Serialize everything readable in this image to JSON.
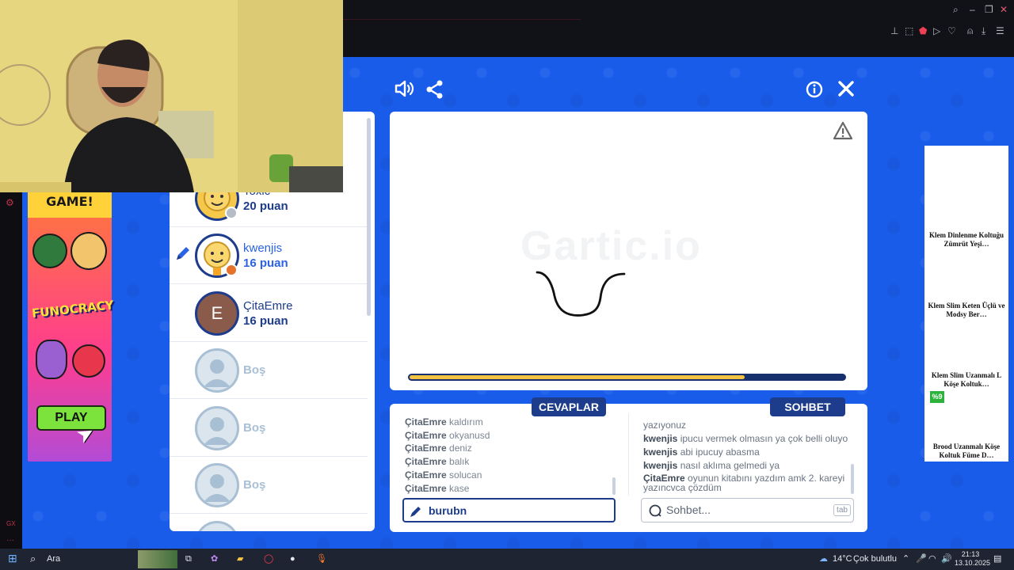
{
  "browser": {
    "icons": [
      "search-icon",
      "minimize-icon",
      "restore-icon",
      "close-icon",
      "pin-icon",
      "snapshot-icon",
      "pocket-icon",
      "play-icon",
      "heart-icon",
      "account-icon",
      "download-icon",
      "menu-icon"
    ]
  },
  "game_toolbar": {
    "left_icons": [
      "sound-icon",
      "share-icon"
    ],
    "right_icons": [
      "info-icon",
      "close-icon"
    ]
  },
  "ad_left": {
    "top_text": "GAME!",
    "brand": "FUNOCRACY",
    "play_label": "PLAY"
  },
  "players": [
    {
      "name": "Toxic",
      "score": "20 puan",
      "status": "offline"
    },
    {
      "name": "kwenjis",
      "score": "16 puan",
      "status": "drawing"
    },
    {
      "name": "ÇitaEmre",
      "score": "16 puan",
      "initial": "E"
    },
    {
      "name": "Boş"
    },
    {
      "name": "Boş"
    },
    {
      "name": "Boş"
    }
  ],
  "canvas": {
    "watermark": "Gartic.io",
    "warning_icon": "warning-icon",
    "timer_fraction": 0.77
  },
  "answers": {
    "tab_label": "CEVAPLAR",
    "lines": [
      {
        "user": "ÇitaEmre",
        "text": "kaldırım"
      },
      {
        "user": "ÇitaEmre",
        "text": "okyanusd"
      },
      {
        "user": "ÇitaEmre",
        "text": "deniz"
      },
      {
        "user": "ÇitaEmre",
        "text": "balık"
      },
      {
        "user": "ÇitaEmre",
        "text": "solucan"
      },
      {
        "user": "ÇitaEmre",
        "text": "kase"
      }
    ],
    "input_value": "burubn"
  },
  "chat": {
    "tab_label": "SOHBET",
    "lines": [
      {
        "user": "",
        "text": "yazıyonuz"
      },
      {
        "user": "kwenjis",
        "text": "ipucu vermek olmasın ya çok belli oluyo"
      },
      {
        "user": "kwenjis",
        "text": "abi ipucuy abasma"
      },
      {
        "user": "kwenjis",
        "text": "nasıl aklıma gelmedi ya"
      },
      {
        "user": "ÇitaEmre",
        "text": "oyunun kitabını yazdım amk 2. kareyi yazıncvca çözdüm"
      }
    ],
    "input_placeholder": "Sohbet...",
    "shortcut": "tab"
  },
  "ad_right": {
    "items": [
      "Klem Dinlenme Koltuğu Zümrüt Yeşi…",
      "Klem Slim Keten Üçlü ve Modsy Ber…",
      "Klem Slim Uzanmalı L Köşe Koltuk…",
      "Brood Uzanmalı Köşe Koltuk Füme D…"
    ],
    "badge": "%9"
  },
  "taskbar": {
    "search_label": "Ara",
    "weather_temp": "14°C",
    "weather_desc": "Çok bulutlu",
    "time": "21:13",
    "date": "13.10.2025"
  },
  "colors": {
    "game_blue": "#1a5cea",
    "navy": "#1d3c8c",
    "timer_yellow": "#f1c142"
  }
}
